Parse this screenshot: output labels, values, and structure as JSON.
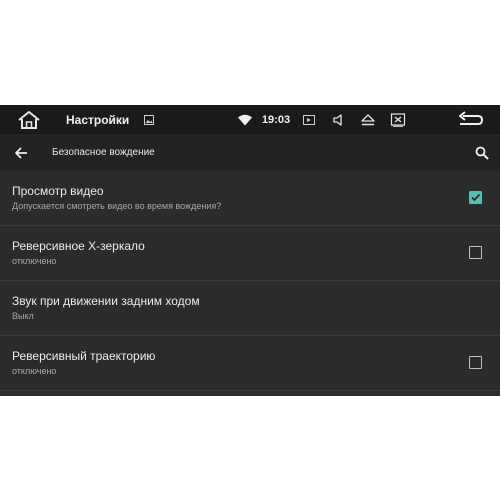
{
  "status_bar": {
    "home_icon": "home-icon",
    "app_title": "Настройки",
    "clock": "19:03",
    "icons": [
      "image-icon",
      "wifi-icon",
      "media-icon",
      "volume-icon",
      "eject-icon",
      "close-box-icon",
      "back-icon"
    ]
  },
  "toolbar": {
    "back_icon": "arrow-left-icon",
    "title": "Безопасное вождение",
    "search_icon": "search-icon"
  },
  "settings": {
    "items": [
      {
        "title": "Просмотр видео",
        "subtitle": "Допускается смотреть видео во время вождения?",
        "checkbox": true,
        "checked": true
      },
      {
        "title": "Реверсивное X-зеркало",
        "subtitle": "отключено",
        "checkbox": true,
        "checked": false
      },
      {
        "title": "Звук при движении задним ходом",
        "subtitle": "Выкл",
        "checkbox": false,
        "checked": false
      },
      {
        "title": "Реверсивный траекторию",
        "subtitle": "отключено",
        "checkbox": true,
        "checked": false
      }
    ]
  },
  "colors": {
    "background": "#2b2b2b",
    "status_bar": "#1a1a1a",
    "toolbar": "#232323",
    "accent": "#5dbcb0",
    "divider": "#3b3b3b"
  }
}
